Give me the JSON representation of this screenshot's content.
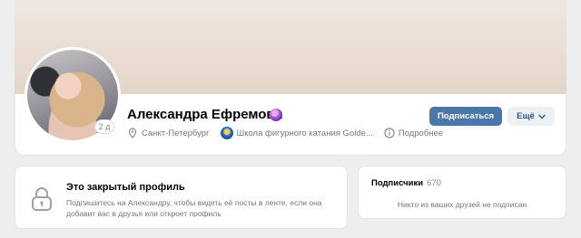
{
  "profile": {
    "name": "Александра Ефремова",
    "online_label": "2 д",
    "city": "Санкт-Петербург",
    "school": "Школа фигурного катания Golde...",
    "details_label": "Подробнее"
  },
  "actions": {
    "subscribe_label": "Подписаться",
    "more_label": "Ещё"
  },
  "closed_profile": {
    "title": "Это закрытый профиль",
    "description": "Подпишитесь на Александру, чтобы видеть её посты в ленте, если она добавит вас в друзья или откроет профиль"
  },
  "subscribers": {
    "title": "Подписчики",
    "count": "670",
    "empty_text": "Никто из ваших друзей не подписан"
  },
  "colors": {
    "accent": "#4a76a8",
    "background": "#edeef0"
  }
}
